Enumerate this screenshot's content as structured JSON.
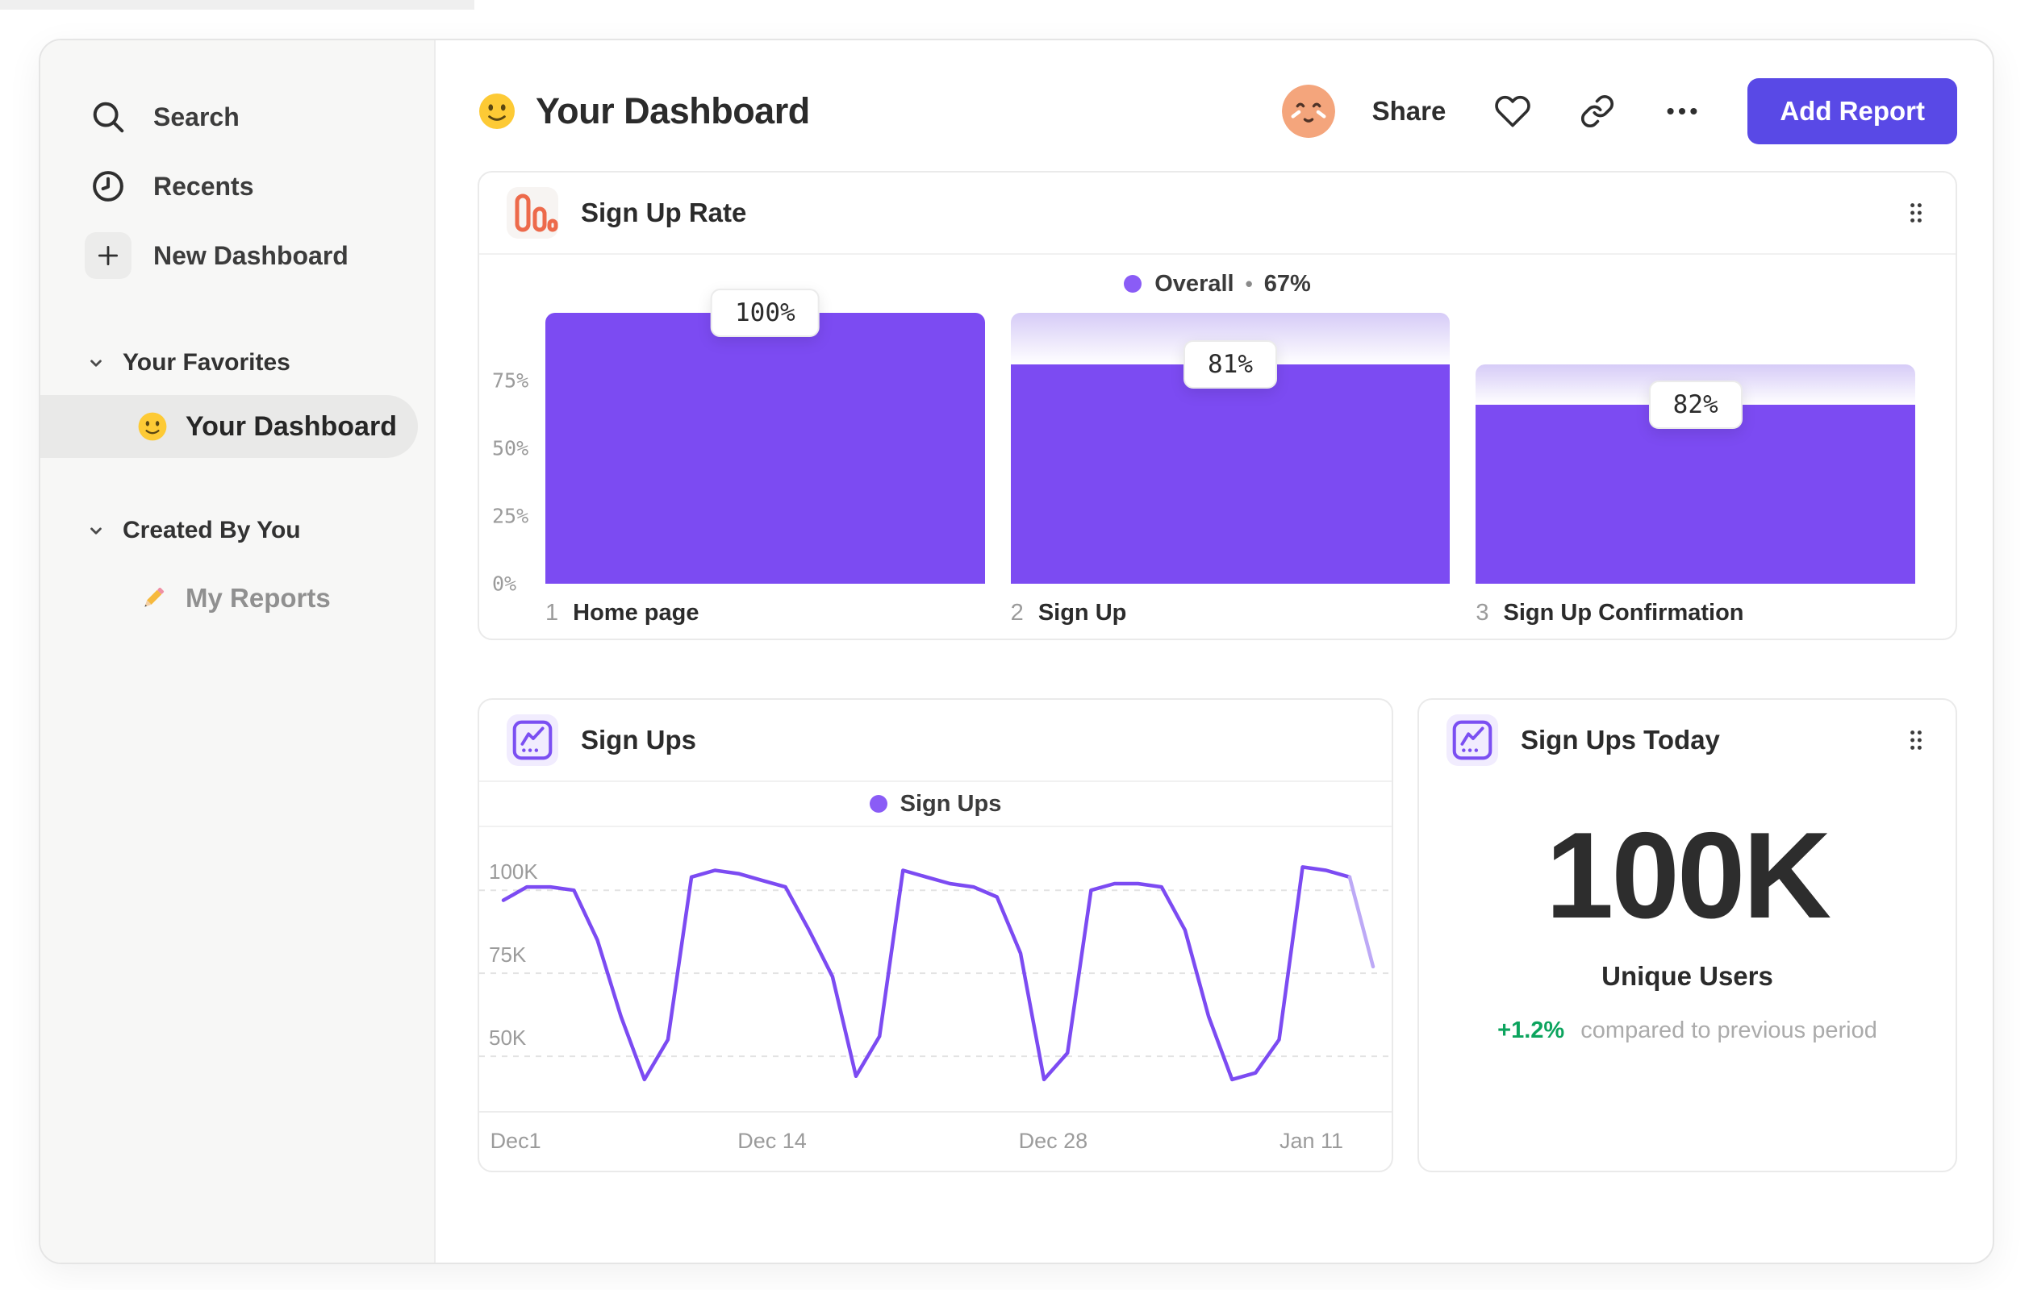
{
  "sidebar": {
    "items": [
      {
        "label": "Search",
        "icon": "search-icon"
      },
      {
        "label": "Recents",
        "icon": "clock-icon"
      },
      {
        "label": "New Dashboard",
        "icon": "plus-icon"
      }
    ],
    "sections": [
      {
        "label": "Your Favorites",
        "children": [
          {
            "label": "Your Dashboard",
            "icon": "smiley-emoji",
            "selected": true
          }
        ]
      },
      {
        "label": "Created By You",
        "children": [
          {
            "label": "My Reports",
            "icon": "pencil-emoji",
            "selected": false
          }
        ]
      }
    ]
  },
  "header": {
    "emoji": "smiley-emoji",
    "title": "Your Dashboard",
    "share_label": "Share",
    "add_report_label": "Add Report",
    "icons": [
      "avatar",
      "heart-icon",
      "link-icon",
      "ellipsis-icon"
    ]
  },
  "cards": {
    "sign_up_rate": {
      "title": "Sign Up Rate",
      "icon": "bar-chart-icon",
      "legend_name": "Overall",
      "legend_sep": "•",
      "legend_value": "67%"
    },
    "sign_ups": {
      "title": "Sign Ups",
      "icon": "line-chart-icon",
      "legend_name": "Sign Ups"
    },
    "sign_ups_today": {
      "title": "Sign Ups Today",
      "icon": "line-chart-icon",
      "value": "100K",
      "label": "Unique Users",
      "delta": "+1.2%",
      "delta_caption": "compared to previous period"
    }
  },
  "colors": {
    "accent_purple": "#7c4bf2",
    "ghost_gradient_top": "#d6cbf7",
    "faded_line": "#bda9f6",
    "button_indigo": "#5949e6",
    "positive_green": "#0ca45e",
    "icon_orange": "#ed6a4b"
  },
  "chart_data": [
    {
      "id": "sign_up_rate_funnel",
      "type": "bar",
      "title": "Sign Up Rate",
      "legend": "Overall • 67%",
      "overall_conversion_pct": 67,
      "step_numbers": [
        "1",
        "2",
        "3"
      ],
      "categories": [
        "Home page",
        "Sign Up",
        "Sign Up Confirmation"
      ],
      "step_conversion_labels": [
        "100%",
        "81%",
        "82%"
      ],
      "values_pct_of_previous_step": [
        100,
        81,
        82
      ],
      "solid_pct": [
        100,
        81,
        66
      ],
      "ghost_pct": [
        100,
        100,
        81
      ],
      "yticks": [
        {
          "label": "75%",
          "frac": 0.75
        },
        {
          "label": "50%",
          "frac": 0.5
        },
        {
          "label": "25%",
          "frac": 0.25
        },
        {
          "label": "0%",
          "frac": 0.0
        }
      ],
      "ylim": [
        0,
        100
      ],
      "grid": false,
      "legend_position": "top-center"
    },
    {
      "id": "sign_ups_line",
      "type": "line",
      "series": [
        {
          "name": "Sign Ups",
          "values_thousands": [
            97,
            101,
            101,
            100,
            85,
            62,
            43,
            55,
            104,
            106,
            105,
            103,
            101,
            88,
            74,
            44,
            56,
            106,
            104,
            102,
            101,
            98,
            81,
            43,
            51,
            100,
            102,
            102,
            101,
            88,
            62,
            43,
            45,
            55,
            107,
            106,
            104,
            77
          ]
        }
      ],
      "faded_tail_segments": 1,
      "x_ticks": [
        {
          "label": "Dec1",
          "frac": 0.012,
          "align": "left"
        },
        {
          "label": "Dec 14",
          "frac": 0.321,
          "align": "center"
        },
        {
          "label": "Dec 28",
          "frac": 0.629,
          "align": "center"
        },
        {
          "label": "Jan 11",
          "frac": 0.912,
          "align": "center"
        }
      ],
      "y_ticks": [
        {
          "label": "100K",
          "value": 100
        },
        {
          "label": "75K",
          "value": 75
        },
        {
          "label": "50K",
          "value": 50
        }
      ],
      "ylim_thousands": [
        33.5,
        119
      ],
      "grid": "dashed-horizontal",
      "legend_position": "top-center"
    }
  ]
}
